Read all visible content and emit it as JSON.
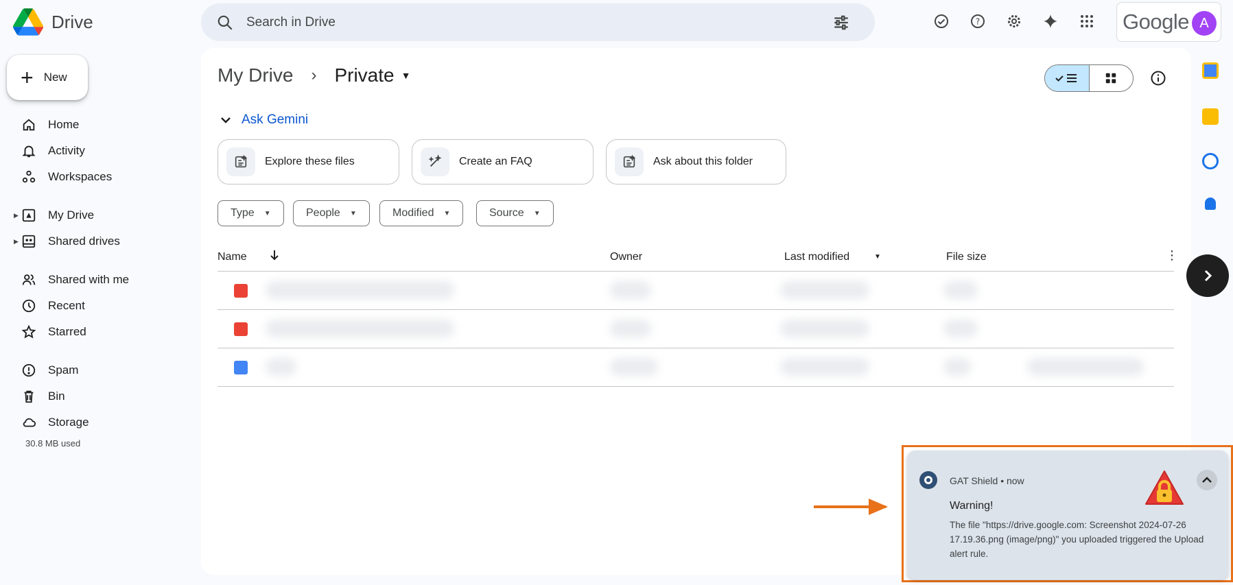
{
  "app": {
    "name": "Drive",
    "account_brand": "Google",
    "avatar_letter": "A"
  },
  "search": {
    "placeholder": "Search in Drive"
  },
  "sidebar": {
    "new_label": "New",
    "items": [
      {
        "label": "Home",
        "icon": "home-icon"
      },
      {
        "label": "Activity",
        "icon": "bell-icon"
      },
      {
        "label": "Workspaces",
        "icon": "workspaces-icon"
      },
      {
        "label": "My Drive",
        "icon": "my-drive-icon"
      },
      {
        "label": "Shared drives",
        "icon": "shared-drives-icon"
      },
      {
        "label": "Shared with me",
        "icon": "people-icon"
      },
      {
        "label": "Recent",
        "icon": "clock-icon"
      },
      {
        "label": "Starred",
        "icon": "star-icon"
      },
      {
        "label": "Spam",
        "icon": "spam-icon"
      },
      {
        "label": "Bin",
        "icon": "bin-icon"
      },
      {
        "label": "Storage",
        "icon": "cloud-icon"
      }
    ],
    "storage_used": "30.8 MB used"
  },
  "main": {
    "breadcrumb": {
      "root": "My Drive",
      "current": "Private"
    },
    "gemini": {
      "heading": "Ask Gemini",
      "cards": [
        "Explore these files",
        "Create an FAQ",
        "Ask about this folder"
      ]
    },
    "filters": [
      "Type",
      "People",
      "Modified",
      "Source"
    ],
    "columns": {
      "name": "Name",
      "owner": "Owner",
      "modified": "Last modified",
      "size": "File size"
    },
    "rows": [
      {
        "type": "image"
      },
      {
        "type": "image"
      },
      {
        "type": "doc"
      }
    ]
  },
  "notification": {
    "app": "GAT Shield",
    "time": "now",
    "title": "Warning!",
    "body": "The file \"https://drive.google.com: Screenshot 2024-07-26 17.19.36.png (image/png)\" you uploaded triggered the Upload alert rule."
  },
  "colors": {
    "accent": "#0b57d0",
    "highlight": "#e8711a",
    "selected": "#c2e7ff"
  }
}
